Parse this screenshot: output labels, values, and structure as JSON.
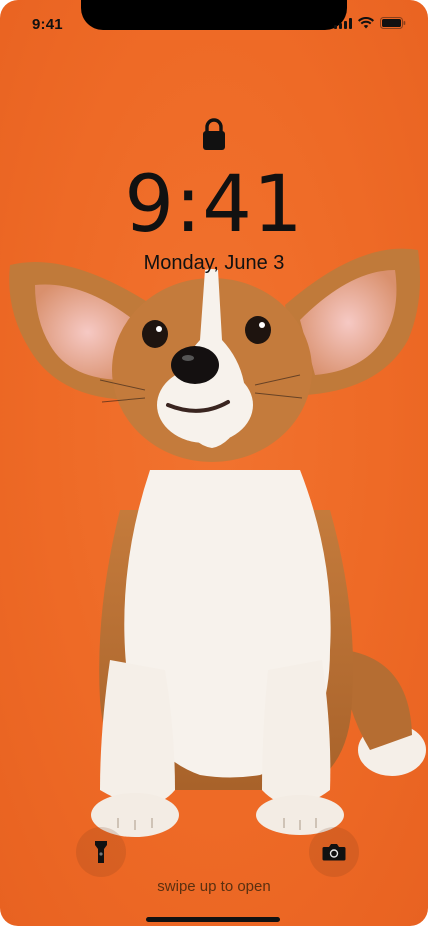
{
  "status_bar": {
    "time": "9:41",
    "signal_icon": "cellular-signal-icon",
    "wifi_icon": "wifi-icon",
    "battery_icon": "battery-icon"
  },
  "lock_screen": {
    "lock_icon": "padlock-icon",
    "clock": "9:41",
    "date": "Monday, June 3",
    "wallpaper": "corgi-puppy-on-orange",
    "background_color": "#ee6a26"
  },
  "controls": {
    "flashlight_icon": "flashlight-icon",
    "camera_icon": "camera-icon",
    "swipe_hint": "swipe up to open"
  }
}
